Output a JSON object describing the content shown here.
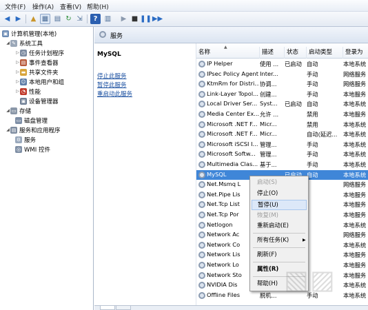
{
  "menubar": {
    "items": [
      "文件(F)",
      "操作(A)",
      "查看(V)",
      "帮助(H)"
    ]
  },
  "tree": {
    "root": "计算机管理(本地)",
    "items": [
      {
        "label": "系统工具",
        "level": 1
      },
      {
        "label": "任务计划程序",
        "level": 2
      },
      {
        "label": "事件查看器",
        "level": 2
      },
      {
        "label": "共享文件夹",
        "level": 2
      },
      {
        "label": "本地用户和组",
        "level": 2
      },
      {
        "label": "性能",
        "level": 2
      },
      {
        "label": "设备管理器",
        "level": 2
      },
      {
        "label": "存储",
        "level": 1
      },
      {
        "label": "磁盘管理",
        "level": 2
      },
      {
        "label": "服务和应用程序",
        "level": 1
      },
      {
        "label": "服务",
        "level": 2
      },
      {
        "label": "WMI 控件",
        "level": 2
      }
    ]
  },
  "panel": {
    "title": "服务"
  },
  "detail": {
    "service_name": "MySQL",
    "links": [
      "停止此服务",
      "暂停此服务",
      "重启动此服务"
    ]
  },
  "columns": [
    "名称",
    "描述",
    "状态",
    "启动类型",
    "登录为"
  ],
  "services": [
    [
      "IP Helper",
      "使用 ...",
      "已启动",
      "自动",
      "本地系统"
    ],
    [
      "IPsec Policy Agent",
      "Inter...",
      "",
      "手动",
      "网络服务"
    ],
    [
      "KtmRm for Distri...",
      "协调...",
      "",
      "手动",
      "网络服务"
    ],
    [
      "Link-Layer Topol...",
      "创建...",
      "",
      "手动",
      "本地服务"
    ],
    [
      "Local Driver Ser...",
      "Syst...",
      "已启动",
      "自动",
      "本地系统"
    ],
    [
      "Media Center Ex...",
      "允许 ...",
      "",
      "禁用",
      "本地服务"
    ],
    [
      "Microsoft .NET F...",
      "Micr...",
      "",
      "禁用",
      "本地系统"
    ],
    [
      "Microsoft .NET F...",
      "Micr...",
      "",
      "自动(延迟...",
      "本地系统"
    ],
    [
      "Microsoft iSCSI I...",
      "管理...",
      "",
      "手动",
      "本地系统"
    ],
    [
      "Microsoft Softw...",
      "管理...",
      "",
      "手动",
      "本地系统"
    ],
    [
      "Multimedia Clas...",
      "基于...",
      "",
      "手动",
      "本地系统"
    ],
    [
      "MySQL",
      "",
      "已启动",
      "自动",
      "本地系统"
    ],
    [
      "Net.Msmq L",
      "",
      "",
      "",
      "网络服务"
    ],
    [
      "Net.Pipe Lis",
      "",
      "",
      "",
      "本地服务"
    ],
    [
      "Net.Tcp List",
      "",
      "",
      "",
      "本地服务"
    ],
    [
      "Net.Tcp Por",
      "",
      "",
      "",
      "本地服务"
    ],
    [
      "Netlogon",
      "",
      "",
      "",
      "本地系统"
    ],
    [
      "Network Ac",
      "",
      "",
      "",
      "网络服务"
    ],
    [
      "Network Co",
      "",
      "",
      "",
      "本地系统"
    ],
    [
      "Network Lis",
      "",
      "",
      "",
      "本地服务"
    ],
    [
      "Network Lo",
      "",
      "",
      "",
      "本地服务"
    ],
    [
      "Network Sto",
      "",
      "",
      "",
      "本地服务"
    ],
    [
      "NVIDIA Dis",
      "",
      "",
      "",
      "本地系统"
    ],
    [
      "Offline Files",
      "脱机...",
      "",
      "手动",
      "本地系统"
    ]
  ],
  "context_menu": {
    "items": [
      {
        "label": "启动(S)",
        "disabled": true
      },
      {
        "label": "停止(O)",
        "disabled": false
      },
      {
        "label": "暂停(U)",
        "disabled": false,
        "highlight": true
      },
      {
        "label": "恢复(M)",
        "disabled": true
      },
      {
        "label": "重新启动(E)",
        "disabled": false
      },
      {
        "label": "所有任务(K)",
        "disabled": false,
        "submenu": true
      },
      {
        "label": "刷新(F)",
        "disabled": false
      },
      {
        "label": "属性(R)",
        "disabled": false,
        "bold": true
      },
      {
        "label": "帮助(H)",
        "disabled": false
      }
    ]
  },
  "icons": [
    "back-icon",
    "forward-icon",
    "up-folder-icon",
    "show-tree-icon",
    "properties-icon",
    "refresh-icon",
    "export-icon",
    "help-icon",
    "view-icon",
    "play-icon",
    "stop-icon",
    "pause-icon",
    "restart-icon"
  ],
  "colors": {
    "selection": "#3f86d8",
    "link": "#1a4fa0",
    "header_bg": "#dbe4f1"
  }
}
